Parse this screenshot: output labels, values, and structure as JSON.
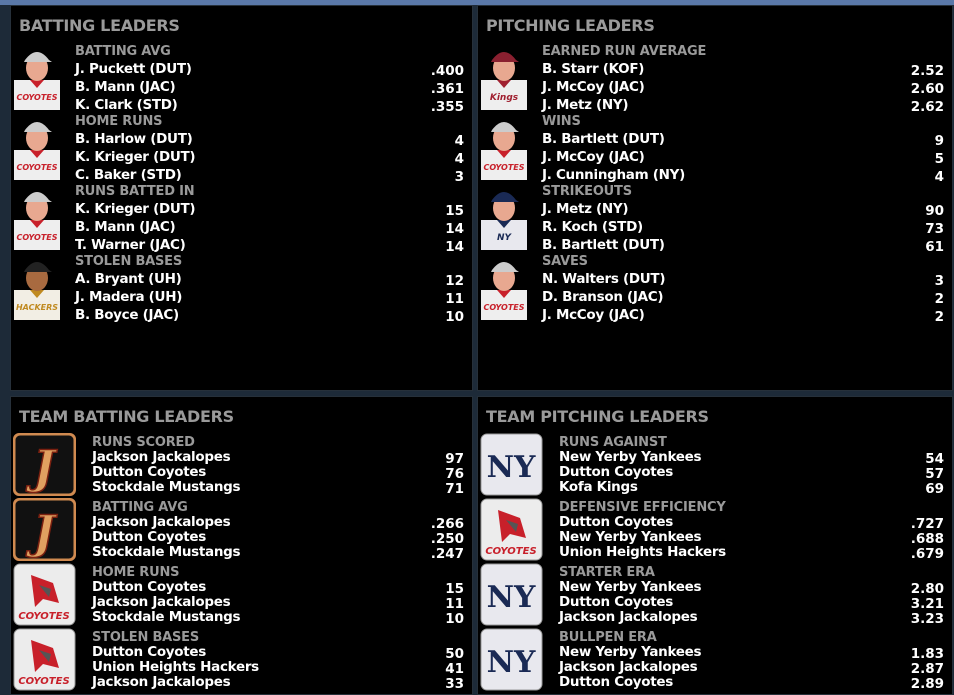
{
  "panels": [
    {
      "title": "BATTING LEADERS",
      "kind": "player",
      "groups": [
        {
          "category": "BATTING AVG",
          "photo": "coyotes",
          "rows": [
            [
              "J. Puckett (DUT)",
              ".400"
            ],
            [
              "B. Mann (JAC)",
              ".361"
            ],
            [
              "K. Clark (STD)",
              ".355"
            ]
          ]
        },
        {
          "category": "HOME RUNS",
          "photo": "coyotes",
          "rows": [
            [
              "B. Harlow (DUT)",
              "4"
            ],
            [
              "K. Krieger (DUT)",
              "4"
            ],
            [
              "C. Baker (STD)",
              "3"
            ]
          ]
        },
        {
          "category": "RUNS BATTED IN",
          "photo": "coyotes",
          "rows": [
            [
              "K. Krieger (DUT)",
              "15"
            ],
            [
              "B. Mann (JAC)",
              "14"
            ],
            [
              "T. Warner (JAC)",
              "14"
            ]
          ]
        },
        {
          "category": "STOLEN BASES",
          "photo": "hackers",
          "rows": [
            [
              "A. Bryant (UH)",
              "12"
            ],
            [
              "J. Madera (UH)",
              "11"
            ],
            [
              "B. Boyce (JAC)",
              "10"
            ]
          ]
        }
      ]
    },
    {
      "title": "PITCHING LEADERS",
      "kind": "player",
      "groups": [
        {
          "category": "EARNED RUN AVERAGE",
          "photo": "kings",
          "rows": [
            [
              "B. Starr (KOF)",
              "2.52"
            ],
            [
              "J. McCoy (JAC)",
              "2.60"
            ],
            [
              "J. Metz (NY)",
              "2.62"
            ]
          ]
        },
        {
          "category": "WINS",
          "photo": "coyotes",
          "rows": [
            [
              "B. Bartlett (DUT)",
              "9"
            ],
            [
              "J. McCoy (JAC)",
              "5"
            ],
            [
              "J. Cunningham (NY)",
              "4"
            ]
          ]
        },
        {
          "category": "STRIKEOUTS",
          "photo": "yankees",
          "rows": [
            [
              "J. Metz (NY)",
              "90"
            ],
            [
              "R. Koch (STD)",
              "73"
            ],
            [
              "B. Bartlett (DUT)",
              "61"
            ]
          ]
        },
        {
          "category": "SAVES",
          "photo": "coyotes",
          "rows": [
            [
              "N. Walters (DUT)",
              "3"
            ],
            [
              "D. Branson (JAC)",
              "2"
            ],
            [
              "J. McCoy (JAC)",
              "2"
            ]
          ]
        }
      ]
    },
    {
      "title": "TEAM BATTING LEADERS",
      "kind": "team",
      "groups": [
        {
          "category": "RUNS SCORED",
          "logo": "jackalopes",
          "rows": [
            [
              "Jackson Jackalopes",
              "97"
            ],
            [
              "Dutton Coyotes",
              "76"
            ],
            [
              "Stockdale Mustangs",
              "71"
            ]
          ]
        },
        {
          "category": "BATTING AVG",
          "logo": "jackalopes",
          "rows": [
            [
              "Jackson Jackalopes",
              ".266"
            ],
            [
              "Dutton Coyotes",
              ".250"
            ],
            [
              "Stockdale Mustangs",
              ".247"
            ]
          ]
        },
        {
          "category": "HOME RUNS",
          "logo": "coyotes",
          "rows": [
            [
              "Dutton Coyotes",
              "15"
            ],
            [
              "Jackson Jackalopes",
              "11"
            ],
            [
              "Stockdale Mustangs",
              "10"
            ]
          ]
        },
        {
          "category": "STOLEN BASES",
          "logo": "coyotes",
          "rows": [
            [
              "Dutton Coyotes",
              "50"
            ],
            [
              "Union Heights Hackers",
              "41"
            ],
            [
              "Jackson Jackalopes",
              "33"
            ]
          ]
        }
      ]
    },
    {
      "title": "TEAM PITCHING LEADERS",
      "kind": "team",
      "groups": [
        {
          "category": "RUNS AGAINST",
          "logo": "yankees",
          "rows": [
            [
              "New Yerby Yankees",
              "54"
            ],
            [
              "Dutton Coyotes",
              "57"
            ],
            [
              "Kofa Kings",
              "69"
            ]
          ]
        },
        {
          "category": "DEFENSIVE EFFICIENCY",
          "logo": "coyotes",
          "rows": [
            [
              "Dutton Coyotes",
              ".727"
            ],
            [
              "New Yerby Yankees",
              ".688"
            ],
            [
              "Union Heights Hackers",
              ".679"
            ]
          ]
        },
        {
          "category": "STARTER ERA",
          "logo": "yankees",
          "rows": [
            [
              "New Yerby Yankees",
              "2.80"
            ],
            [
              "Dutton Coyotes",
              "3.21"
            ],
            [
              "Jackson Jackalopes",
              "3.23"
            ]
          ]
        },
        {
          "category": "BULLPEN ERA",
          "logo": "yankees",
          "rows": [
            [
              "New Yerby Yankees",
              "1.83"
            ],
            [
              "Jackson Jackalopes",
              "2.87"
            ],
            [
              "Dutton Coyotes",
              "2.89"
            ]
          ]
        }
      ]
    }
  ],
  "logo_text": {
    "coyotes": "COYOTES",
    "jackalopes": "J",
    "yankees": "NY",
    "hackers": "HACKERS",
    "kings": "Kings"
  }
}
